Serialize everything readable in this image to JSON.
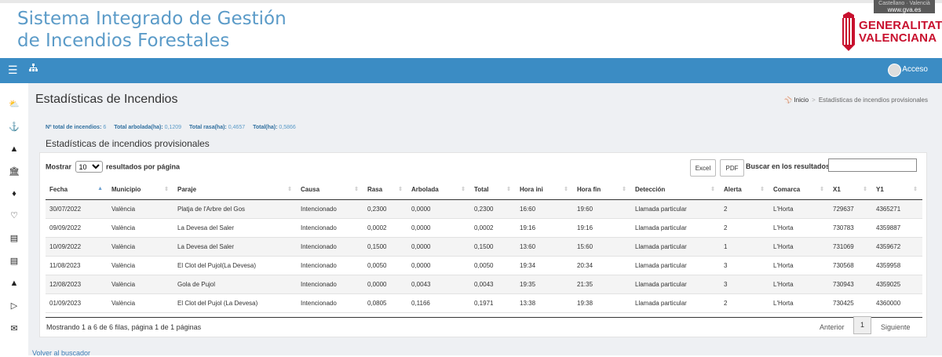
{
  "header": {
    "title_line1": "Sistema Integrado de Gestión",
    "title_line2": "de Incendios Forestales",
    "lang": "Castellano · Valencià",
    "gva_link": "www.gva.es",
    "logo_line1": "GENERALITAT",
    "logo_line2": "VALENCIANA",
    "logo_color": "#c8102e"
  },
  "navbar": {
    "menu_icon": "hamburger-icon",
    "sitemap_icon": "sitemap-icon",
    "user_label": "Acceso",
    "color": "#3b8cc4"
  },
  "sidebar": {
    "icons": [
      "weather-icon",
      "ship-icon",
      "tree-icon",
      "building-icon",
      "fire-icon",
      "heart-icon",
      "document-icon",
      "document-icon",
      "graduation-cap-icon",
      "megaphone-icon",
      "envelope-icon"
    ]
  },
  "page": {
    "title": "Estadísticas de Incendios",
    "breadcrumb_home": "Inicio",
    "breadcrumb_current": "Estadísticas de incendios provisionales"
  },
  "totals": {
    "n_label": "Nº total de incendios:",
    "n_value": "6",
    "arbolada_label": "Total arbolada(ha):",
    "arbolada_value": "0,1209",
    "rasa_label": "Total rasa(ha):",
    "rasa_value": "0,4657",
    "total_label": "Total(ha):",
    "total_value": "0,5866"
  },
  "table": {
    "title": "Estadísticas de incendios provisionales",
    "show_prefix": "Mostrar",
    "show_value": "10",
    "show_suffix": "resultados por página",
    "excel_label": "Excel",
    "pdf_label": "PDF",
    "search_label": "Buscar en los resultados:",
    "search_value": "",
    "columns": [
      "Fecha",
      "Municipio",
      "Paraje",
      "Causa",
      "Rasa",
      "Arbolada",
      "Total",
      "Hora ini",
      "Hora fin",
      "Detección",
      "Alerta",
      "Comarca",
      "X1",
      "Y1"
    ],
    "rows": [
      [
        "30/07/2022",
        "València",
        "Platja de l'Arbre del Gos",
        "Intencionado",
        "0,2300",
        "0,0000",
        "0,2300",
        "16:60",
        "19:60",
        "Llamada particular",
        "2",
        "L'Horta",
        "729637",
        "4365271"
      ],
      [
        "09/09/2022",
        "València",
        "La Devesa del Saler",
        "Intencionado",
        "0,0002",
        "0,0000",
        "0,0002",
        "19:16",
        "19:16",
        "Llamada particular",
        "2",
        "L'Horta",
        "730783",
        "4359887"
      ],
      [
        "10/09/2022",
        "València",
        "La Devesa del Saler",
        "Intencionado",
        "0,1500",
        "0,0000",
        "0,1500",
        "13:60",
        "15:60",
        "Llamada particular",
        "1",
        "L'Horta",
        "731069",
        "4359672"
      ],
      [
        "11/08/2023",
        "València",
        "El Clot del Pujol(La Devesa)",
        "Intencionado",
        "0,0050",
        "0,0000",
        "0,0050",
        "19:34",
        "20:34",
        "Llamada particular",
        "3",
        "L'Horta",
        "730568",
        "4359958"
      ],
      [
        "12/08/2023",
        "València",
        "Gola de Pujol",
        "Intencionado",
        "0,0000",
        "0,0043",
        "0,0043",
        "19:35",
        "21:35",
        "Llamada particular",
        "3",
        "L'Horta",
        "730943",
        "4359025"
      ],
      [
        "01/09/2023",
        "València",
        "El Clot del Pujol (La Devesa)",
        "Intencionado",
        "0,0805",
        "0,1166",
        "0,1971",
        "13:38",
        "19:38",
        "Llamada particular",
        "2",
        "L'Horta",
        "730425",
        "4360000"
      ]
    ],
    "info": "Mostrando 1 a 6 de 6 filas, página 1 de 1 páginas",
    "prev_label": "Anterior",
    "page_number": "1",
    "next_label": "Siguiente"
  },
  "footer": {
    "back_link": "Volver al buscador"
  }
}
